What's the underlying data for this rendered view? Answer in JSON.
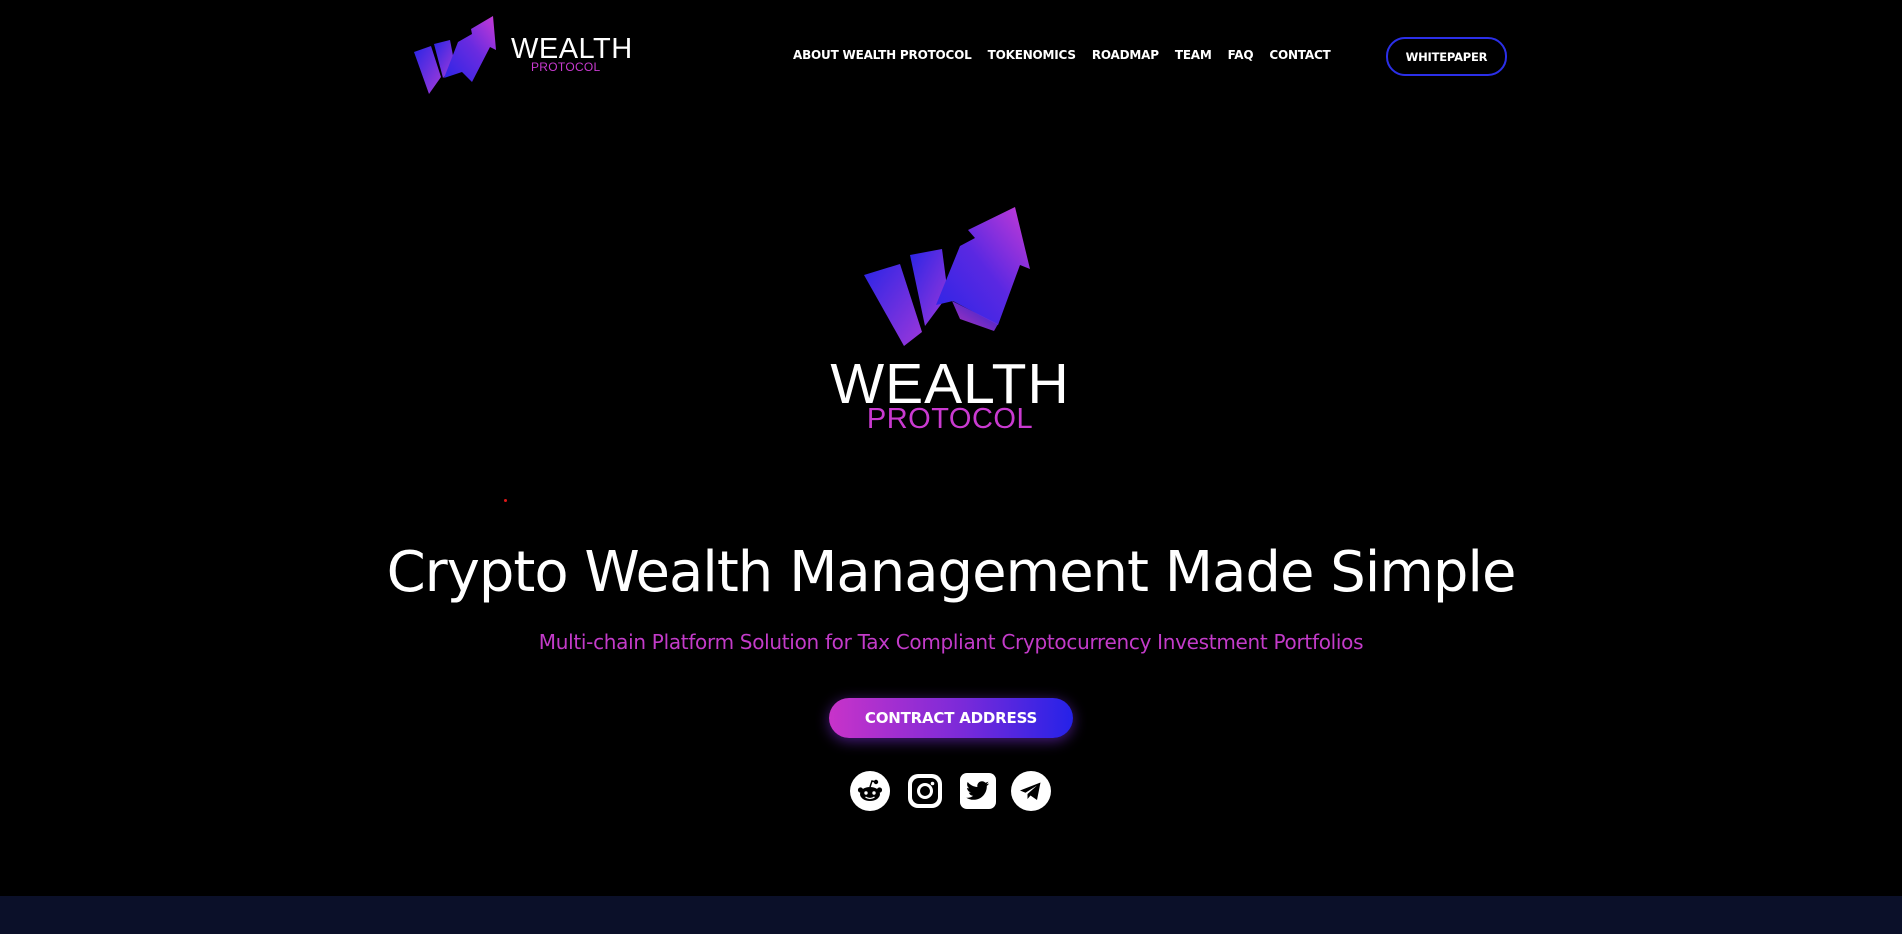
{
  "header": {
    "logo": {
      "name": "WEALTH",
      "sub": "PROTOCOL"
    },
    "nav": [
      {
        "label": "ABOUT WEALTH PROTOCOL"
      },
      {
        "label": "TOKENOMICS"
      },
      {
        "label": "ROADMAP"
      },
      {
        "label": "TEAM"
      },
      {
        "label": "FAQ"
      },
      {
        "label": "CONTACT"
      }
    ],
    "whitepaper_label": "WHITEPAPER"
  },
  "hero": {
    "logo": {
      "name": "WEALTH",
      "sub": "PROTOCOL"
    },
    "headline": "Crypto Wealth Management Made Simple",
    "subheadline": "Multi-chain Platform Solution for Tax Compliant Cryptocurrency Investment Portfolios",
    "cta_label": "CONTRACT ADDRESS",
    "socials": [
      {
        "icon": "reddit-icon"
      },
      {
        "icon": "instagram-icon"
      },
      {
        "icon": "twitter-icon"
      },
      {
        "icon": "telegram-icon"
      }
    ]
  },
  "colors": {
    "background": "#000000",
    "accent_magenta": "#c93ad0",
    "accent_blue": "#2b2fe8",
    "footer_band": "#0b1029"
  }
}
